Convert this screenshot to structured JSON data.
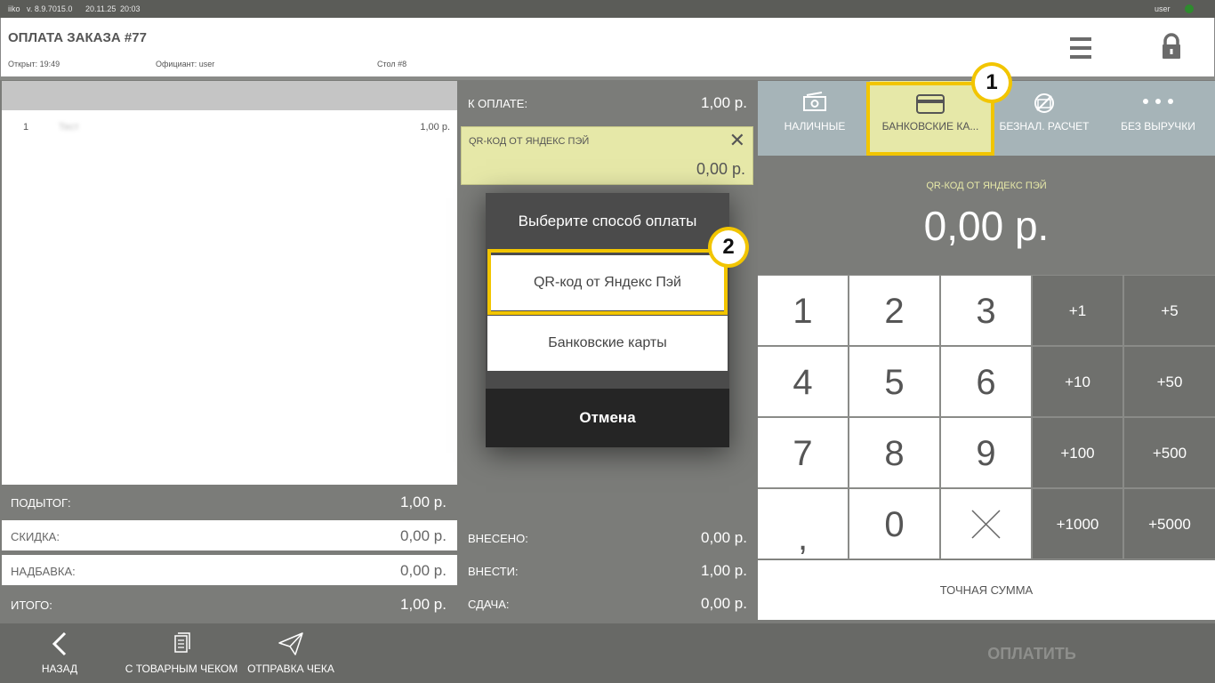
{
  "statusbar": {
    "app": "iiko",
    "version": "v. 8.9.7015.0",
    "date": "20.11.25",
    "time": "20:03",
    "user": "user",
    "online_color": "#2e8b2e"
  },
  "header": {
    "title": "ОПЛАТА ЗАКАЗА #77",
    "opened": "Открыт: 19:49",
    "waiter": "Официант: user",
    "table": "Стол #8",
    "menu_icon": "hamburger-icon",
    "lock_icon": "lock-icon"
  },
  "order": {
    "items": [
      {
        "num": "1",
        "name": "Тест",
        "price": "1,00 р."
      }
    ]
  },
  "totals": {
    "subtotal_label": "ПОДЫТОГ:",
    "subtotal_value": "1,00 р.",
    "discount_label": "СКИДКА:",
    "discount_value": "0,00 р.",
    "surcharge_label": "НАДБАВКА:",
    "surcharge_value": "0,00 р.",
    "total_label": "ИТОГО:",
    "total_value": "1,00 р."
  },
  "payment": {
    "to_pay_label": "К ОПЛАТЕ:",
    "to_pay_value": "1,00 р.",
    "card_title": "QR-КОД ОТ ЯНДЕКС ПЭЙ",
    "card_amount": "0,00 р.",
    "paid_label": "ВНЕСЕНО:",
    "paid_value": "0,00 р.",
    "due_label": "ВНЕСТИ:",
    "due_value": "1,00 р.",
    "change_label": "СДАЧА:",
    "change_value": "0,00 р."
  },
  "modal": {
    "title": "Выберите способ оплаты",
    "options": [
      "QR-код от Яндекс Пэй",
      "Банковские карты"
    ],
    "cancel": "Отмена"
  },
  "callouts": {
    "one": "1",
    "two": "2",
    "color": "#f2c500"
  },
  "paytypes": [
    {
      "label": "НАЛИЧНЫЕ",
      "icon": "cash-icon"
    },
    {
      "label": "БАНКОВСКИЕ КА...",
      "icon": "card-icon",
      "selected": true
    },
    {
      "label": "БЕЗНАЛ. РАСЧЕТ",
      "icon": "cashless-icon"
    },
    {
      "label": "БЕЗ ВЫРУЧКИ",
      "icon": "more-icon"
    }
  ],
  "amount": {
    "label": "QR-КОД ОТ ЯНДЕКС ПЭЙ",
    "value": "0,00 р."
  },
  "keypad": {
    "digits": [
      "1",
      "2",
      "3",
      "4",
      "5",
      "6",
      "7",
      "8",
      "9",
      ",",
      "0"
    ],
    "clear_icon": "clear-x-icon",
    "adds": [
      "+1",
      "+5",
      "+10",
      "+50",
      "+100",
      "+500",
      "+1000",
      "+5000"
    ],
    "exact": "ТОЧНАЯ СУММА"
  },
  "footer": {
    "back": "НАЗАД",
    "with_receipt": "С ТОВАРНЫМ ЧЕКОМ",
    "send_receipt": "ОТПРАВКА ЧЕКА",
    "pay": "ОПЛАТИТЬ"
  },
  "colors": {
    "accent_yellow": "#e6e8a8",
    "panel_gray": "#7b7c79",
    "highlight": "#f2c500"
  }
}
